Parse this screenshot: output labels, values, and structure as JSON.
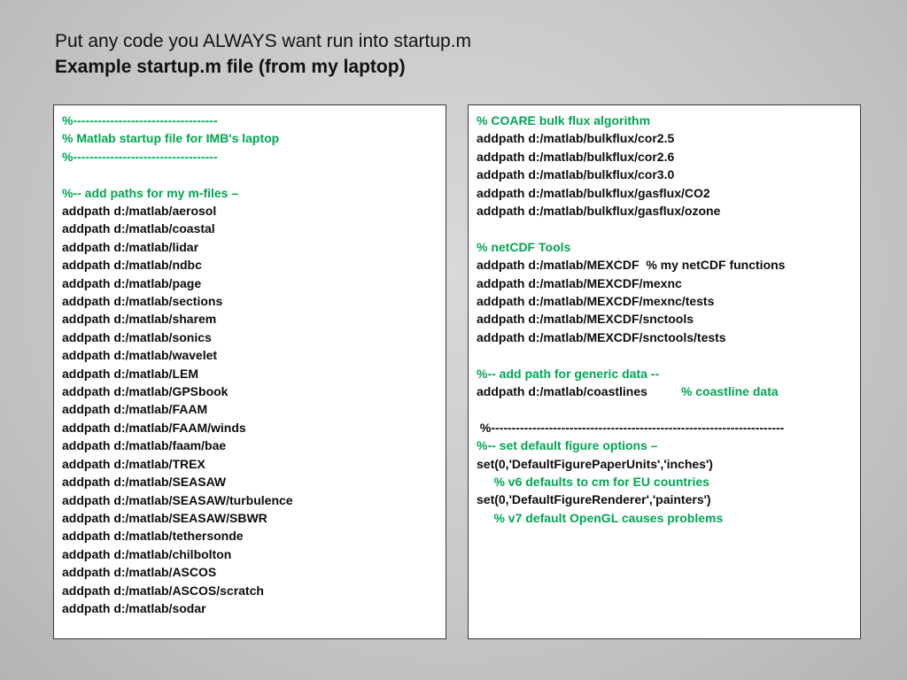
{
  "title": {
    "line1": "Put any code you ALWAYS want run into startup.m",
    "line2": "Example startup.m file (from my laptop)"
  },
  "left_panel": {
    "lines": [
      {
        "text": "%-----------------------------------",
        "kind": "comment"
      },
      {
        "text": "% Matlab startup file for IMB's laptop",
        "kind": "comment"
      },
      {
        "text": "%-----------------------------------",
        "kind": "comment"
      },
      {
        "text": "",
        "kind": "blank"
      },
      {
        "text": "%-- add paths for my m-files –",
        "kind": "comment"
      },
      {
        "text": "addpath d:/matlab/aerosol",
        "kind": "code"
      },
      {
        "text": "addpath d:/matlab/coastal",
        "kind": "code"
      },
      {
        "text": "addpath d:/matlab/lidar",
        "kind": "code"
      },
      {
        "text": "addpath d:/matlab/ndbc",
        "kind": "code"
      },
      {
        "text": "addpath d:/matlab/page",
        "kind": "code"
      },
      {
        "text": "addpath d:/matlab/sections",
        "kind": "code"
      },
      {
        "text": "addpath d:/matlab/sharem",
        "kind": "code"
      },
      {
        "text": "addpath d:/matlab/sonics",
        "kind": "code"
      },
      {
        "text": "addpath d:/matlab/wavelet",
        "kind": "code"
      },
      {
        "text": "addpath d:/matlab/LEM",
        "kind": "code"
      },
      {
        "text": "addpath d:/matlab/GPSbook",
        "kind": "code"
      },
      {
        "text": "addpath d:/matlab/FAAM",
        "kind": "code"
      },
      {
        "text": "addpath d:/matlab/FAAM/winds",
        "kind": "code"
      },
      {
        "text": "addpath d:/matlab/faam/bae",
        "kind": "code"
      },
      {
        "text": "addpath d:/matlab/TREX",
        "kind": "code"
      },
      {
        "text": "addpath d:/matlab/SEASAW",
        "kind": "code"
      },
      {
        "text": "addpath d:/matlab/SEASAW/turbulence",
        "kind": "code"
      },
      {
        "text": "addpath d:/matlab/SEASAW/SBWR",
        "kind": "code"
      },
      {
        "text": "addpath d:/matlab/tethersonde",
        "kind": "code"
      },
      {
        "text": "addpath d:/matlab/chilbolton",
        "kind": "code"
      },
      {
        "text": "addpath d:/matlab/ASCOS",
        "kind": "code"
      },
      {
        "text": "addpath d:/matlab/ASCOS/scratch",
        "kind": "code"
      },
      {
        "text": "addpath d:/matlab/sodar",
        "kind": "code"
      }
    ]
  },
  "right_panel": {
    "lines": [
      {
        "text": "% COARE bulk flux algorithm",
        "kind": "comment"
      },
      {
        "text": "addpath d:/matlab/bulkflux/cor2.5",
        "kind": "code"
      },
      {
        "text": "addpath d:/matlab/bulkflux/cor2.6",
        "kind": "code"
      },
      {
        "text": "addpath d:/matlab/bulkflux/cor3.0",
        "kind": "code"
      },
      {
        "text": "addpath d:/matlab/bulkflux/gasflux/CO2",
        "kind": "code"
      },
      {
        "text": "addpath d:/matlab/bulkflux/gasflux/ozone",
        "kind": "code"
      },
      {
        "text": "",
        "kind": "blank"
      },
      {
        "text": "% netCDF Tools",
        "kind": "comment"
      },
      {
        "text": "addpath d:/matlab/MEXCDF  % my netCDF functions",
        "kind": "code"
      },
      {
        "text": "addpath d:/matlab/MEXCDF/mexnc",
        "kind": "code"
      },
      {
        "text": "addpath d:/matlab/MEXCDF/mexnc/tests",
        "kind": "code"
      },
      {
        "text": "addpath d:/matlab/MEXCDF/snctools",
        "kind": "code"
      },
      {
        "text": "addpath d:/matlab/MEXCDF/snctools/tests",
        "kind": "code"
      },
      {
        "text": "",
        "kind": "blank"
      },
      {
        "text": "%-- add path for generic data --",
        "kind": "comment"
      },
      {
        "text": "addpath d:/matlab/coastlines",
        "kind": "code",
        "trailing_comment": "% coastline data"
      },
      {
        "text": "",
        "kind": "blank"
      },
      {
        "text": " %-----------------------------------------------------------------------",
        "kind": "code"
      },
      {
        "text": "%-- set default figure options –",
        "kind": "comment"
      },
      {
        "text": "set(0,'DefaultFigurePaperUnits','inches')",
        "kind": "code"
      },
      {
        "text": "     % v6 defaults to cm for EU countries",
        "kind": "comment"
      },
      {
        "text": "set(0,'DefaultFigureRenderer','painters')",
        "kind": "code"
      },
      {
        "text": "     % v7 default OpenGL causes problems",
        "kind": "comment"
      }
    ]
  }
}
